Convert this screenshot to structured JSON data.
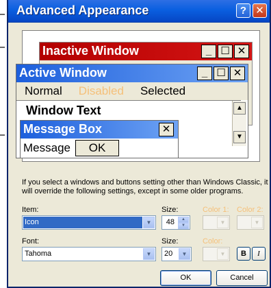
{
  "dialog": {
    "title": "Advanced Appearance",
    "help_glyph": "?",
    "close_glyph": "✕"
  },
  "preview": {
    "inactive_window_title": "Inactive Window",
    "active_window_title": "Active Window",
    "caption_buttons": [
      "_",
      "☐",
      "✕"
    ],
    "menu": {
      "normal": "Normal",
      "disabled": "Disabled",
      "selected": "Selected"
    },
    "window_text": "Window Text",
    "message_box_title": "Message Box",
    "message_box_close": "✕",
    "message_text": "Message",
    "ok_text": "OK"
  },
  "info_text": "If you select a windows and buttons setting other than Windows Classic, it will override the following settings, except in some older programs.",
  "item": {
    "label": "Item:",
    "value": "Icon",
    "size_label": "Size:",
    "size_value": "48",
    "color1_label": "Color 1:",
    "color2_label": "Color 2:"
  },
  "font": {
    "label": "Font:",
    "value": "Tahoma",
    "size_label": "Size:",
    "size_value": "20",
    "color_label": "Color:",
    "bold_label": "B",
    "italic_label": "I"
  },
  "buttons": {
    "ok": "OK",
    "cancel": "Cancel"
  },
  "colors": {
    "titlebar": "#0a5fe0",
    "inactive_caption": "#c20a0a",
    "active_caption": "#1d5fdc",
    "dialog_bg": "#ece9d8",
    "disabled_text": "#f5c07a",
    "selection": "#316ac5"
  }
}
